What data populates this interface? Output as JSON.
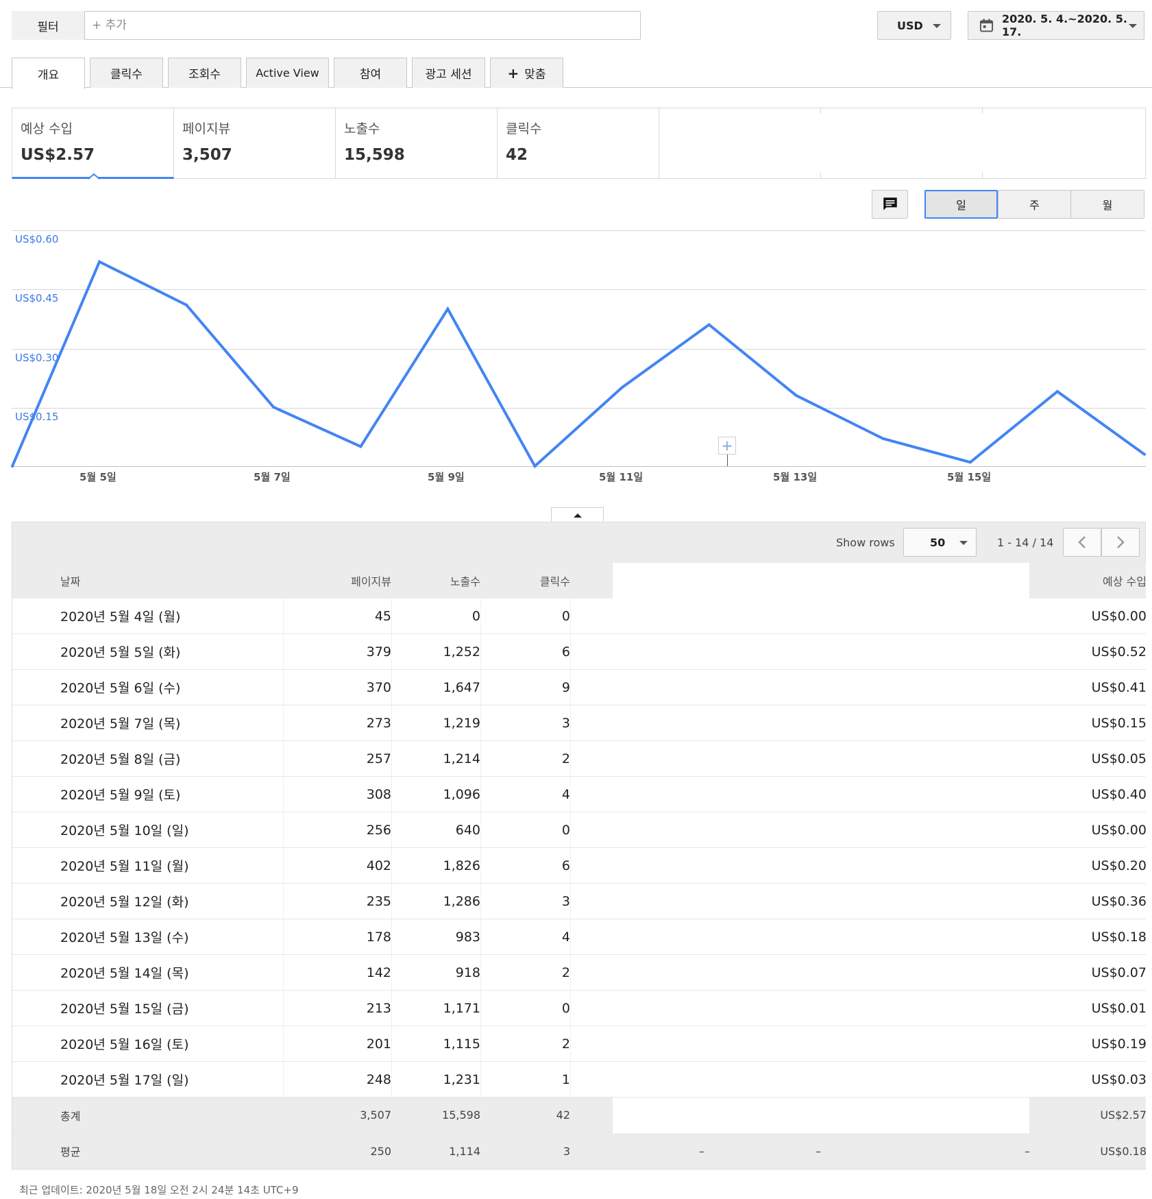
{
  "filter": {
    "label": "필터",
    "placeholder": "+ 추가"
  },
  "currency": {
    "value": "USD"
  },
  "date_range": {
    "value": "2020. 5. 4.~2020. 5. 17."
  },
  "tabs": [
    {
      "label": "개요"
    },
    {
      "label": "클릭수"
    },
    {
      "label": "조회수"
    },
    {
      "label": "Active View"
    },
    {
      "label": "참여"
    },
    {
      "label": "광고 세션"
    },
    {
      "label": "맞춤"
    }
  ],
  "metrics": [
    {
      "label": "예상 수입",
      "value": "US$2.57"
    },
    {
      "label": "페이지뷰",
      "value": "3,507"
    },
    {
      "label": "노출수",
      "value": "15,598"
    },
    {
      "label": "클릭수",
      "value": "42"
    }
  ],
  "period_buttons": {
    "day": "일",
    "week": "주",
    "month": "월"
  },
  "chart_data": {
    "type": "line",
    "x": [
      "5월 4일",
      "5월 5일",
      "5월 6일",
      "5월 7일",
      "5월 8일",
      "5월 9일",
      "5월 10일",
      "5월 11일",
      "5월 12일",
      "5월 13일",
      "5월 14일",
      "5월 15일",
      "5월 16일",
      "5월 17일"
    ],
    "series": [
      {
        "values": [
          0.0,
          0.52,
          0.41,
          0.15,
          0.05,
          0.4,
          0.0,
          0.2,
          0.36,
          0.18,
          0.07,
          0.01,
          0.19,
          0.03
        ]
      }
    ],
    "ylim": [
      0,
      0.6
    ],
    "y_tick_labels": [
      "US$0.15",
      "US$0.30",
      "US$0.45",
      "US$0.60"
    ],
    "x_tick_labels": [
      "5월 5일",
      "5월 7일",
      "5월 9일",
      "5월 11일",
      "5월 13일",
      "5월 15일"
    ],
    "grid": true,
    "color": "#4285f4"
  },
  "table": {
    "show_rows_label": "Show rows",
    "rows_per_page": "50",
    "range": "1 - 14 / 14",
    "headers": {
      "date": "날짜",
      "pageviews": "페이지뷰",
      "impressions": "노출수",
      "clicks": "클릭수",
      "earnings": "예상 수입"
    },
    "rows": [
      {
        "date": "2020년 5월 4일 (월)",
        "pageviews": "45",
        "impressions": "0",
        "clicks": "0",
        "earnings": "US$0.00"
      },
      {
        "date": "2020년 5월 5일 (화)",
        "pageviews": "379",
        "impressions": "1,252",
        "clicks": "6",
        "earnings": "US$0.52"
      },
      {
        "date": "2020년 5월 6일 (수)",
        "pageviews": "370",
        "impressions": "1,647",
        "clicks": "9",
        "earnings": "US$0.41"
      },
      {
        "date": "2020년 5월 7일 (목)",
        "pageviews": "273",
        "impressions": "1,219",
        "clicks": "3",
        "earnings": "US$0.15"
      },
      {
        "date": "2020년 5월 8일 (금)",
        "pageviews": "257",
        "impressions": "1,214",
        "clicks": "2",
        "earnings": "US$0.05"
      },
      {
        "date": "2020년 5월 9일 (토)",
        "pageviews": "308",
        "impressions": "1,096",
        "clicks": "4",
        "earnings": "US$0.40"
      },
      {
        "date": "2020년 5월 10일 (일)",
        "pageviews": "256",
        "impressions": "640",
        "clicks": "0",
        "earnings": "US$0.00"
      },
      {
        "date": "2020년 5월 11일 (월)",
        "pageviews": "402",
        "impressions": "1,826",
        "clicks": "6",
        "earnings": "US$0.20"
      },
      {
        "date": "2020년 5월 12일 (화)",
        "pageviews": "235",
        "impressions": "1,286",
        "clicks": "3",
        "earnings": "US$0.36"
      },
      {
        "date": "2020년 5월 13일 (수)",
        "pageviews": "178",
        "impressions": "983",
        "clicks": "4",
        "earnings": "US$0.18"
      },
      {
        "date": "2020년 5월 14일 (목)",
        "pageviews": "142",
        "impressions": "918",
        "clicks": "2",
        "earnings": "US$0.07"
      },
      {
        "date": "2020년 5월 15일 (금)",
        "pageviews": "213",
        "impressions": "1,171",
        "clicks": "0",
        "earnings": "US$0.01"
      },
      {
        "date": "2020년 5월 16일 (토)",
        "pageviews": "201",
        "impressions": "1,115",
        "clicks": "2",
        "earnings": "US$0.19"
      },
      {
        "date": "2020년 5월 17일 (일)",
        "pageviews": "248",
        "impressions": "1,231",
        "clicks": "1",
        "earnings": "US$0.03"
      }
    ],
    "total": {
      "label": "총계",
      "pageviews": "3,507",
      "impressions": "15,598",
      "clicks": "42",
      "earnings": "US$2.57"
    },
    "average": {
      "label": "평균",
      "pageviews": "250",
      "impressions": "1,114",
      "clicks": "3",
      "dash1": "–",
      "dash2": "–",
      "dash3": "–",
      "earnings": "US$0.18"
    }
  },
  "footer": {
    "last_updated": "최근 업데이트: 2020년 5월 18일 오전 2시 24분 14초 UTC+9"
  }
}
